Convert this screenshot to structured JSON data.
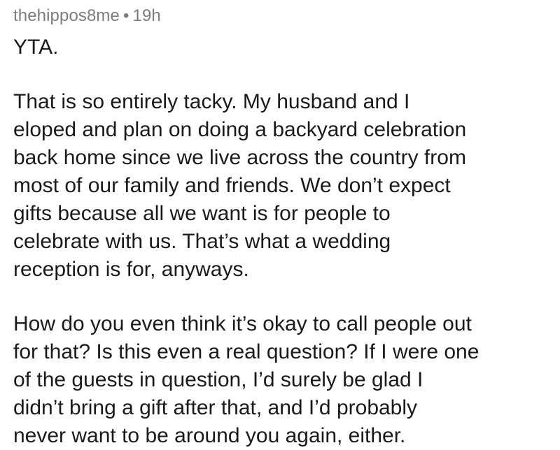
{
  "comment": {
    "username": "thehippos8me",
    "separator": "•",
    "age": "19h",
    "paragraphs": [
      "YTA.",
      "That is so entirely tacky. My husband and I\neloped and plan on doing a backyard celebration\nback home since we live across the country from\nmost of our family and friends. We don’t expect\ngifts because all we want is for people to\ncelebrate with us. That’s what a wedding\nreception is for, anyways.",
      "How do you even think it’s okay to call people out\nfor that? Is this even a real question? If I were one\nof the guests in question, I’d surely be glad I\ndidn’t bring a gift after that, and I’d probably\nnever want to be around you again, either."
    ]
  }
}
